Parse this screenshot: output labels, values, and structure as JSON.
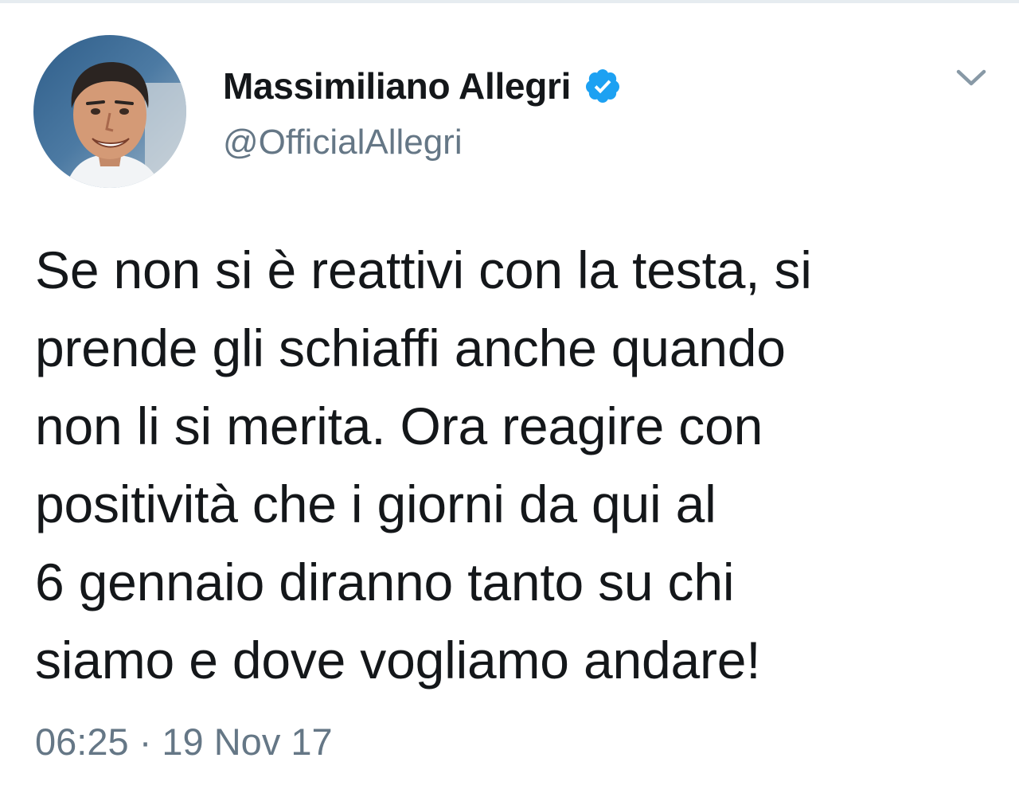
{
  "author": {
    "display_name": "Massimiliano Allegri",
    "handle": "@OfficialAllegri",
    "verified": true,
    "avatar_icon": "avatar-photo"
  },
  "tweet": {
    "text": "Se non si è reattivi con la testa, si\nprende gli schiaffi anche quando\nnon li si merita. Ora reagire con\npositività che i giorni da qui al\n6 gennaio diranno tanto su chi\nsiamo e dove vogliamo andare!",
    "time": "06:25",
    "separator": "·",
    "date": "19 Nov 17"
  },
  "icons": {
    "verified": "verified-badge-icon",
    "menu": "chevron-down-icon"
  },
  "colors": {
    "text_primary": "#14171a",
    "text_secondary": "#657786",
    "verified_blue": "#1da1f2",
    "chevron": "#8899a6",
    "divider": "#e6ecf0"
  }
}
